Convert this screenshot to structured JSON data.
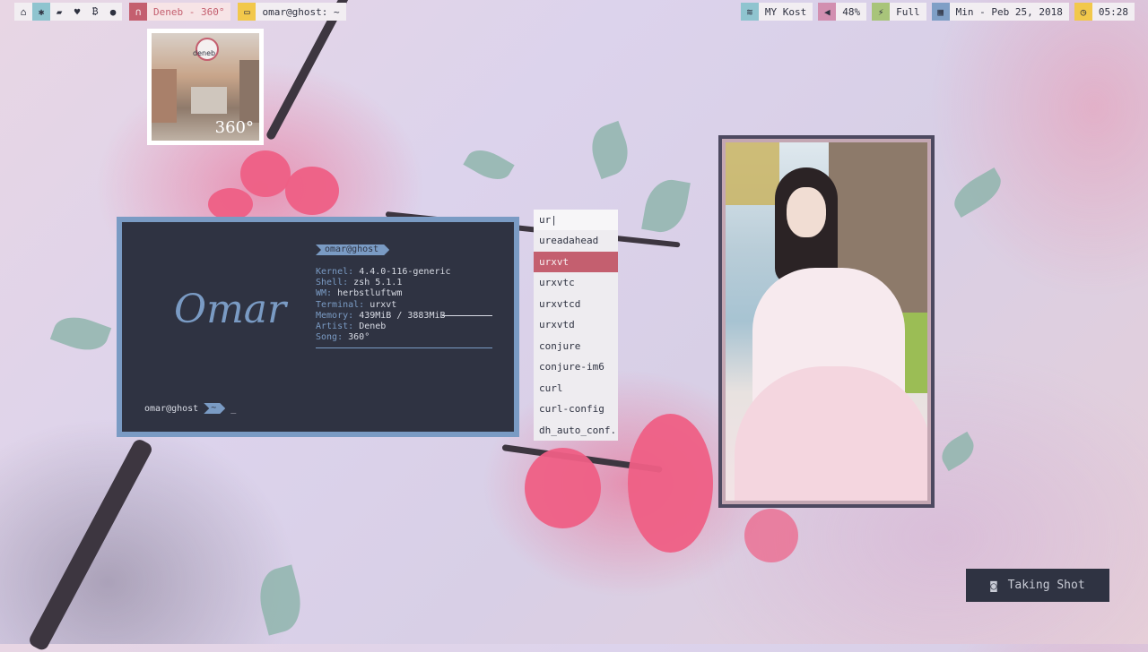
{
  "topbar": {
    "workspace_icons": [
      "home-icon",
      "settings-icon",
      "folder-icon",
      "heartbeat-icon",
      "bitcoin-icon",
      "github-icon"
    ],
    "music": {
      "icon": "headphones-icon",
      "text": "Deneb - 360°"
    },
    "window": {
      "icon": "monitor-icon",
      "title": "omar@ghost: ~"
    },
    "wifi": {
      "icon": "wifi-icon",
      "text": "MY Kost"
    },
    "volume": {
      "icon": "volume-icon",
      "text": "48%"
    },
    "battery": {
      "icon": "plug-icon",
      "text": "Full"
    },
    "date": {
      "icon": "calendar-icon",
      "text": "Min - Peb 25, 2018"
    },
    "clock": {
      "icon": "clock-icon",
      "text": "05:28"
    }
  },
  "album": {
    "label": "deneb",
    "track": "360°"
  },
  "terminal": {
    "logo": "Omar",
    "user": "omar@ghost",
    "info": [
      {
        "key": "Kernel:",
        "value": "4.4.0-116-generic"
      },
      {
        "key": "Shell:",
        "value": "zsh 5.1.1"
      },
      {
        "key": "WM:",
        "value": "herbstluftwm"
      },
      {
        "key": "Terminal:",
        "value": "urxvt"
      },
      {
        "key": "Memory:",
        "value": "439MiB / 3883MiB"
      },
      {
        "key": "Artist:",
        "value": "Deneb"
      },
      {
        "key": "Song:",
        "value": "360°"
      }
    ],
    "prompt_user": "omar@ghost",
    "prompt_dir": "~",
    "cursor": "_"
  },
  "launcher": {
    "query": "ur|",
    "items": [
      "ureadahead",
      "urxvt",
      "urxvtc",
      "urxvtcd",
      "urxvtd",
      "conjure",
      "conjure-im6",
      "curl",
      "curl-config",
      "dh_auto_conf..."
    ],
    "selected_index": 1
  },
  "screenshot_notice": {
    "icon": "camera-icon",
    "text": "Taking Shot"
  },
  "colors": {
    "accent_blue": "#7a9bc4",
    "terminal_bg": "#2f3342",
    "selection_red": "#c45f6f",
    "music_red": "#c45f6f",
    "window_yellow": "#f2c84b",
    "wifi_teal": "#8fc4cf",
    "volume_pink": "#d28fb0",
    "battery_green": "#a8c47a",
    "date_blue": "#7f9fc6",
    "clock_yellow": "#f2c84b"
  }
}
